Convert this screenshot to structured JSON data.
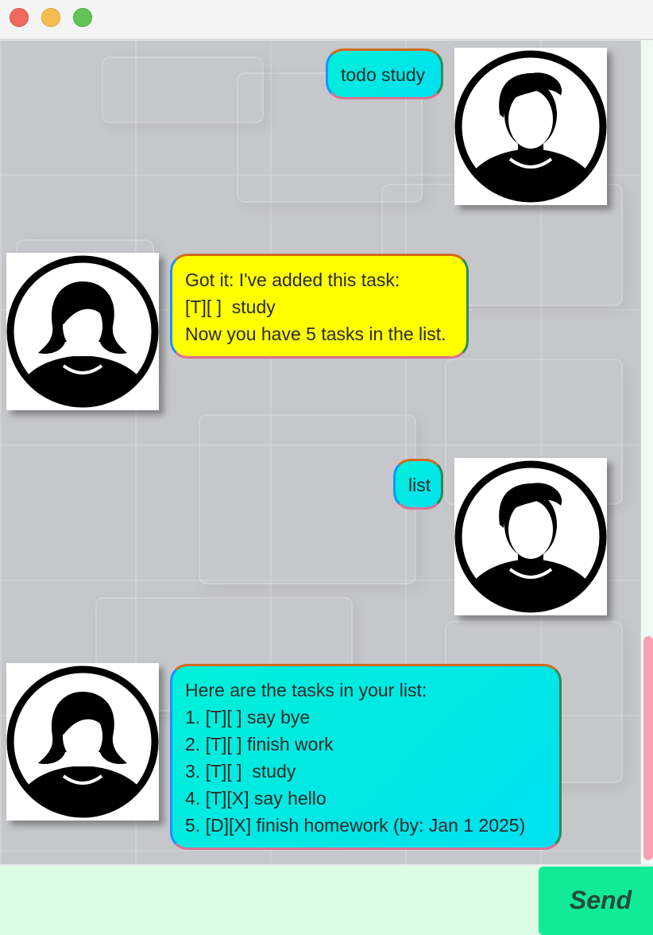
{
  "window": {
    "controls": [
      "close",
      "minimize",
      "maximize"
    ]
  },
  "messages": [
    {
      "sender": "user",
      "avatar": "male-user-avatar-icon",
      "lines": [
        "todo study"
      ]
    },
    {
      "sender": "bot",
      "avatar": "female-bot-avatar-icon",
      "lines": [
        "Got it: I've added this task:",
        "[T][ ]  study",
        "Now you have 5 tasks in the list."
      ]
    },
    {
      "sender": "user",
      "avatar": "male-user-avatar-icon",
      "lines": [
        "list"
      ]
    },
    {
      "sender": "bot",
      "avatar": "female-bot-avatar-icon",
      "lines": [
        "Here are the tasks in your list:",
        "1. [T][ ] say bye",
        "2. [T][ ] finish work",
        "3. [T][ ]  study",
        "4. [T][X] say hello",
        "5. [D][X] finish homework (by: Jan 1 2025)"
      ]
    }
  ],
  "input": {
    "value": "",
    "placeholder": ""
  },
  "send_button": {
    "label": "Send"
  },
  "colors": {
    "user_bubble": "#00e8e4",
    "bot_ack_bubble": "#ffff00",
    "bot_list_bubble": "#00e8e4",
    "input_bg": "#dcfbe5",
    "send_bg": "#11eb96",
    "scroll_thumb": "#f7a3b4"
  }
}
